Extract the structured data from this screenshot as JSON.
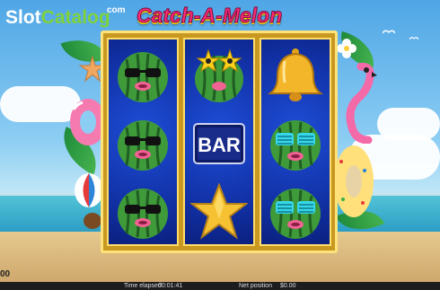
{
  "logo": {
    "part1": "Slot",
    "part2": "Catalog",
    "suffix": "com"
  },
  "game": {
    "title": "Catch-A-Melon"
  },
  "reels": [
    [
      "melon-sunglasses",
      "melon-sunglasses",
      "melon-sunglasses"
    ],
    [
      "melon-star-glasses",
      "bar",
      "star"
    ],
    [
      "bell",
      "melon-shutter-shades",
      "melon-shutter-shades"
    ]
  ],
  "symbols": {
    "bar_text": "BAR"
  },
  "status": {
    "left_balance": "00",
    "time_label": "Time elapsed",
    "time_value": "00:01:41",
    "net_label": "Net position",
    "net_value": "$0.00"
  },
  "colors": {
    "reel_bg": "#1232a8",
    "frame": "#ffde6a",
    "title": "#ff2b78"
  }
}
